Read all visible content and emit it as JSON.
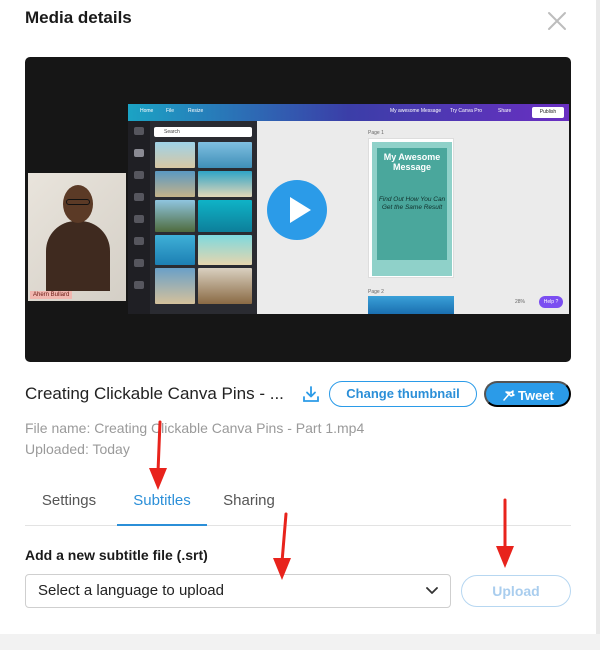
{
  "modal": {
    "title": "Media details",
    "close_icon": "close-icon"
  },
  "video": {
    "play_icon": "play-icon",
    "webcam_name": "Ahern Bullard",
    "canva": {
      "search_placeholder": "Search",
      "home": "Home",
      "file": "File",
      "resize": "Resize",
      "doc_title": "My awesome Message",
      "try_pro": "Try Canva Pro",
      "share": "Share",
      "publish": "Publish",
      "page1_label": "Page 1",
      "page2_label": "Page 2",
      "pin_title": "My Awesome Message",
      "pin_body": "Find Out How You Can Get the Same Result",
      "zoom": "28%",
      "help": "Help ?"
    },
    "colors": {
      "accent": "#2b9be8",
      "annotation": "#e8231c"
    }
  },
  "details": {
    "name": "Creating Clickable Canva Pins - ...",
    "download_icon": "download-icon",
    "change_thumbnail": "Change thumbnail",
    "tweet": "Tweet",
    "file_name": "File name: Creating Clickable Canva Pins - Part 1.mp4",
    "uploaded": "Uploaded: Today"
  },
  "tabs": [
    {
      "label": "Settings",
      "active": false
    },
    {
      "label": "Subtitles",
      "active": true
    },
    {
      "label": "Sharing",
      "active": false
    }
  ],
  "subtitles": {
    "section_label": "Add a new subtitle file (.srt)",
    "language_select": "Select a language to upload",
    "upload": "Upload"
  }
}
